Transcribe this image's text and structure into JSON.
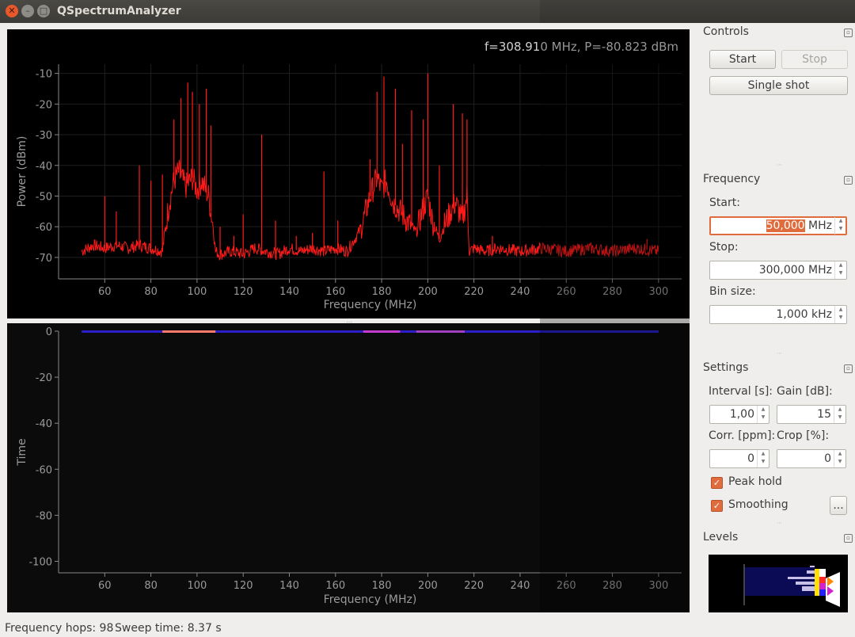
{
  "window": {
    "title": "QSpectrumAnalyzer"
  },
  "spectrum": {
    "cursor_readout": "f=308.910 MHz, P=-80.823 dBm",
    "xlabel": "Frequency (MHz)",
    "ylabel": "Power (dBm)",
    "color": "#ff1a1a"
  },
  "waterfall": {
    "xlabel": "Frequency (MHz)",
    "ylabel": "Time"
  },
  "chart_data": [
    {
      "type": "line",
      "xlabel": "Frequency (MHz)",
      "ylabel": "Power (dBm)",
      "xlim": [
        40,
        310
      ],
      "ylim": [
        -77,
        -7
      ],
      "xticks": [
        60,
        80,
        100,
        120,
        140,
        160,
        180,
        200,
        220,
        240,
        260,
        280,
        300
      ],
      "yticks": [
        -10,
        -20,
        -30,
        -40,
        -50,
        -60,
        -70
      ],
      "series": [
        {
          "color": "#ff1a1a",
          "x": [
            50,
            55,
            60,
            65,
            70,
            75,
            80,
            85,
            86,
            88,
            90,
            92,
            95,
            98,
            100,
            102,
            105,
            107,
            108,
            110,
            115,
            120,
            125,
            130,
            135,
            140,
            145,
            150,
            155,
            160,
            165,
            170,
            172,
            175,
            178,
            180,
            182,
            185,
            188,
            190,
            192,
            195,
            198,
            200,
            202,
            205,
            208,
            210,
            212,
            215,
            217,
            218,
            220,
            225,
            230,
            240,
            250,
            260,
            270,
            280,
            290,
            300
          ],
          "y": [
            -68,
            -66,
            -67,
            -66,
            -67,
            -66,
            -67,
            -68,
            -62,
            -52,
            -45,
            -42,
            -47,
            -44,
            -48,
            -45,
            -50,
            -60,
            -68,
            -69,
            -68,
            -69,
            -67,
            -68,
            -69,
            -67,
            -68,
            -67,
            -68,
            -67,
            -68,
            -62,
            -58,
            -50,
            -44,
            -48,
            -45,
            -52,
            -55,
            -57,
            -59,
            -62,
            -54,
            -50,
            -58,
            -64,
            -58,
            -55,
            -52,
            -58,
            -50,
            -68,
            -67,
            -68,
            -67,
            -68,
            -67,
            -68,
            -67,
            -68,
            -67,
            -68
          ]
        }
      ],
      "peaks": [
        {
          "x": 60,
          "y": -50
        },
        {
          "x": 65,
          "y": -55
        },
        {
          "x": 75,
          "y": -40
        },
        {
          "x": 80,
          "y": -45
        },
        {
          "x": 85,
          "y": -43
        },
        {
          "x": 90,
          "y": -25
        },
        {
          "x": 93,
          "y": -18
        },
        {
          "x": 96,
          "y": -13
        },
        {
          "x": 98,
          "y": -16
        },
        {
          "x": 101,
          "y": -20
        },
        {
          "x": 104,
          "y": -15
        },
        {
          "x": 106,
          "y": -27
        },
        {
          "x": 110,
          "y": -60
        },
        {
          "x": 116,
          "y": -63
        },
        {
          "x": 120,
          "y": -56
        },
        {
          "x": 128,
          "y": -30
        },
        {
          "x": 134,
          "y": -58
        },
        {
          "x": 143,
          "y": -63
        },
        {
          "x": 150,
          "y": -62
        },
        {
          "x": 155,
          "y": -42
        },
        {
          "x": 161,
          "y": -58
        },
        {
          "x": 175,
          "y": -38
        },
        {
          "x": 178,
          "y": -16
        },
        {
          "x": 181,
          "y": -11
        },
        {
          "x": 186,
          "y": -15
        },
        {
          "x": 189,
          "y": -33
        },
        {
          "x": 193,
          "y": -22
        },
        {
          "x": 198,
          "y": -25
        },
        {
          "x": 200,
          "y": -10
        },
        {
          "x": 205,
          "y": -40
        },
        {
          "x": 211,
          "y": -20
        },
        {
          "x": 215,
          "y": -23
        },
        {
          "x": 217,
          "y": -25
        },
        {
          "x": 228,
          "y": -63
        },
        {
          "x": 295,
          "y": -64
        }
      ]
    },
    {
      "type": "heatmap",
      "xlabel": "Frequency (MHz)",
      "ylabel": "Time",
      "xlim": [
        40,
        310
      ],
      "ylim": [
        -105,
        0
      ],
      "xticks": [
        60,
        80,
        100,
        120,
        140,
        160,
        180,
        200,
        220,
        240,
        260,
        280,
        300
      ],
      "yticks": [
        0,
        -20,
        -40,
        -60,
        -80,
        -100
      ],
      "rows": 1,
      "hot_bands": [
        {
          "from": 85,
          "to": 108,
          "color": "#ff7a6a"
        },
        {
          "from": 172,
          "to": 188,
          "color": "#c43bd0"
        },
        {
          "from": 195,
          "to": 216,
          "color": "#a040c0"
        }
      ],
      "base_color": "#2a1fc8"
    }
  ],
  "controls": {
    "header": "Controls",
    "start_label": "Start",
    "stop_label": "Stop",
    "single_shot_label": "Single shot"
  },
  "frequency": {
    "header": "Frequency",
    "start_label": "Start:",
    "start_value_selected": "50,000",
    "start_unit": " MHz",
    "stop_label": "Stop:",
    "stop_value": "300,000 MHz",
    "bin_label": "Bin size:",
    "bin_value": "1,000 kHz"
  },
  "settings": {
    "header": "Settings",
    "interval_label": "Interval [s]:",
    "interval_value": "1,00",
    "gain_label": "Gain [dB]:",
    "gain_value": "15",
    "corr_label": "Corr. [ppm]:",
    "corr_value": "0",
    "crop_label": "Crop [%]:",
    "crop_value": "0",
    "peak_hold_label": "Peak hold",
    "peak_hold_checked": true,
    "smoothing_label": "Smoothing",
    "smoothing_checked": true,
    "smoothing_more_label": "..."
  },
  "levels": {
    "header": "Levels"
  },
  "status": {
    "hops": "Frequency hops: 98",
    "sweep": "Sweep time: 8.37 s"
  }
}
